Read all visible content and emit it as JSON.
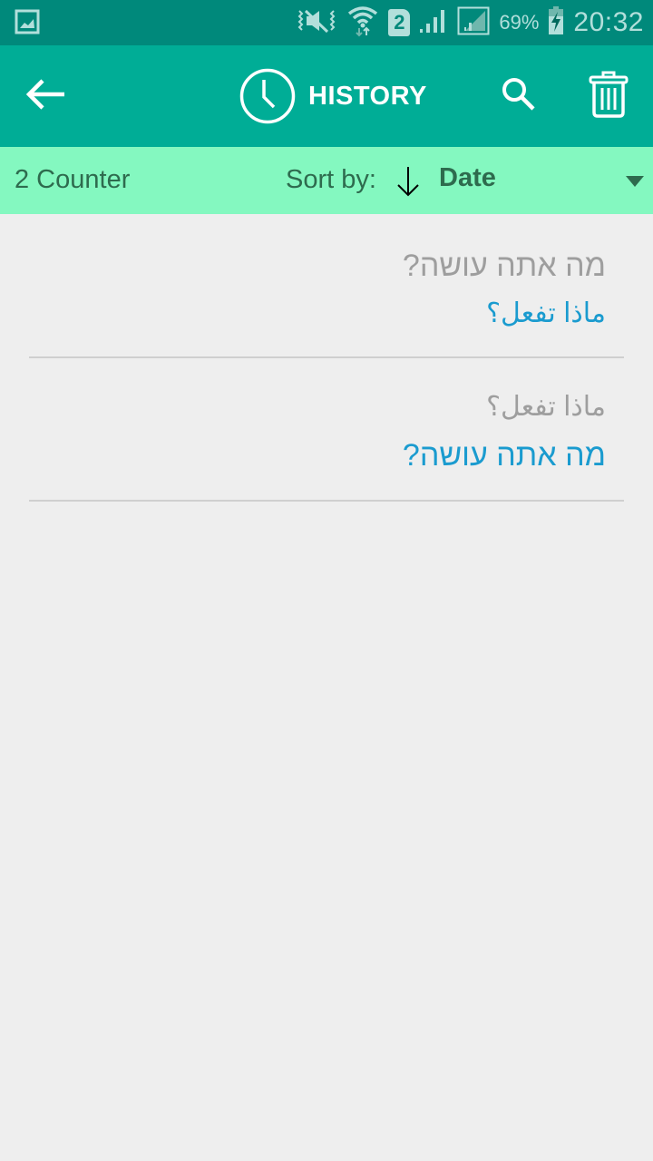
{
  "status_bar": {
    "left_icon": "gallery-notification-icon",
    "icons": [
      "vibrate-mute-icon",
      "wifi-icon",
      "sim-2-icon",
      "signal-icon",
      "signal-sim2-icon",
      "battery-charging-icon"
    ],
    "sim_label": "2",
    "battery": "69%",
    "time": "20:32"
  },
  "toolbar": {
    "back_icon": "arrow-left-icon",
    "title_icon": "clock-icon",
    "title": "HISTORY",
    "search_icon": "search-icon",
    "delete_icon": "trash-icon"
  },
  "sort_bar": {
    "counter": "2 Counter",
    "sort_label": "Sort by:",
    "sort_direction": "descending",
    "sort_value": "Date"
  },
  "history": [
    {
      "source": "מה אתה עושה?",
      "translation": "ماذا تفعل؟"
    },
    {
      "source": "ماذا تفعل؟",
      "translation": "מה אתה עושה?"
    }
  ],
  "colors": {
    "status_bar": "#00897b",
    "toolbar": "#00ad96",
    "sort_bar": "#84f8c0",
    "sort_text": "#2e6b4e",
    "background": "#eeeeee",
    "source_text": "#9e9e9e",
    "translation_text": "#1a9bcf"
  }
}
